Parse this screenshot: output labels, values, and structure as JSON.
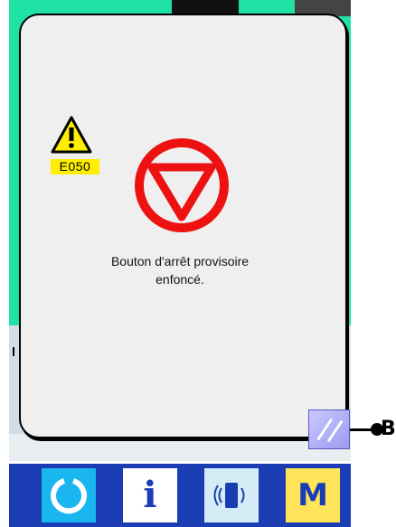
{
  "dialog": {
    "error_code": "E050",
    "message_line1": "Bouton d'arrêt provisoire",
    "message_line2": "enfoncé."
  },
  "callout": {
    "label": "B"
  },
  "bottom_bar": {
    "info_label": "i",
    "mode_label": "M"
  },
  "colors": {
    "background_green": "#1fe1a6",
    "stop_red": "#ee1111",
    "warning_yellow": "#ffee00",
    "bar_blue": "#1a3db3",
    "button_cyan": "#19b6ef",
    "button_yellow": "#ffe45a",
    "reset_purple": "#9b9bef"
  },
  "icons": [
    "warning-triangle-icon",
    "stop-sign-icon",
    "reset-slash-icon",
    "power-arc-icon",
    "info-icon",
    "communication-icon",
    "mode-m-icon"
  ]
}
